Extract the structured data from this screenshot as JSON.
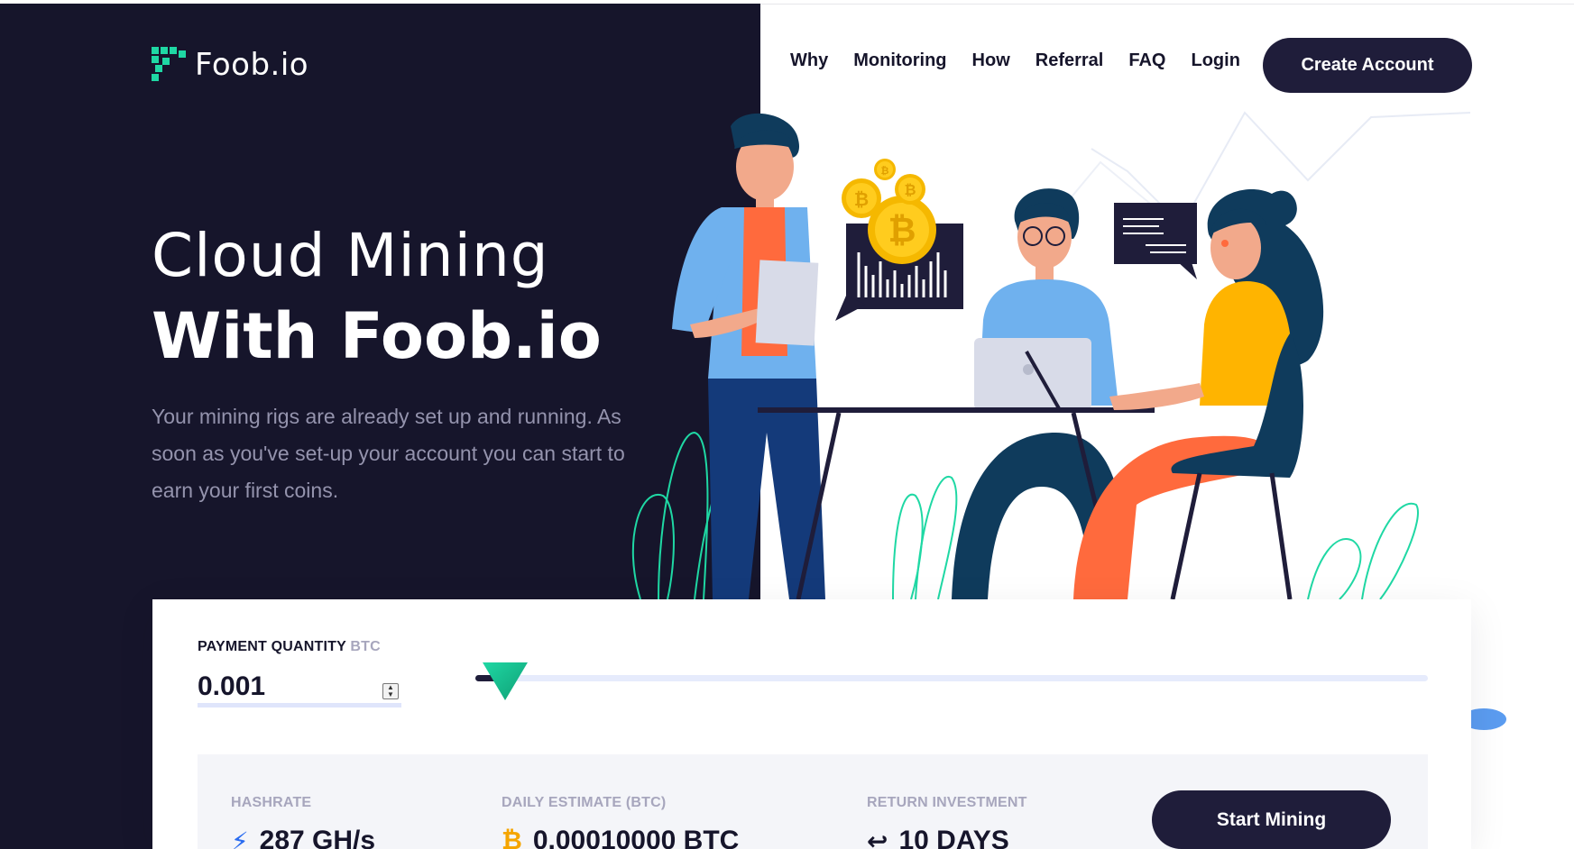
{
  "brand": {
    "name": "Foob.io",
    "accent": "#1fd8a4",
    "dark": "#16152b"
  },
  "nav": {
    "links": [
      "Why",
      "Monitoring",
      "How",
      "Referral",
      "FAQ",
      "Login"
    ],
    "cta": "Create Account"
  },
  "hero": {
    "title_line1": "Cloud Mining",
    "title_line2": "With Foob.io",
    "description": "Your mining rigs are already set up and running. As soon as you've set-up your account you can start to earn your first coins."
  },
  "calculator": {
    "payment_label": "PAYMENT QUANTITY",
    "payment_unit": "BTC",
    "payment_value": "0.001",
    "slider_position": 0.005,
    "stats": [
      {
        "label": "HASHRATE",
        "icon": "lightning-icon",
        "value": "287 GH/s"
      },
      {
        "label": "DAILY ESTIMATE (BTC)",
        "icon": "bitcoin-icon",
        "value": "0.00010000 BTC"
      },
      {
        "label": "RETURN INVESTMENT",
        "icon": "return-arrow-icon",
        "value": "10 DAYS"
      }
    ],
    "start_button": "Start Mining"
  }
}
